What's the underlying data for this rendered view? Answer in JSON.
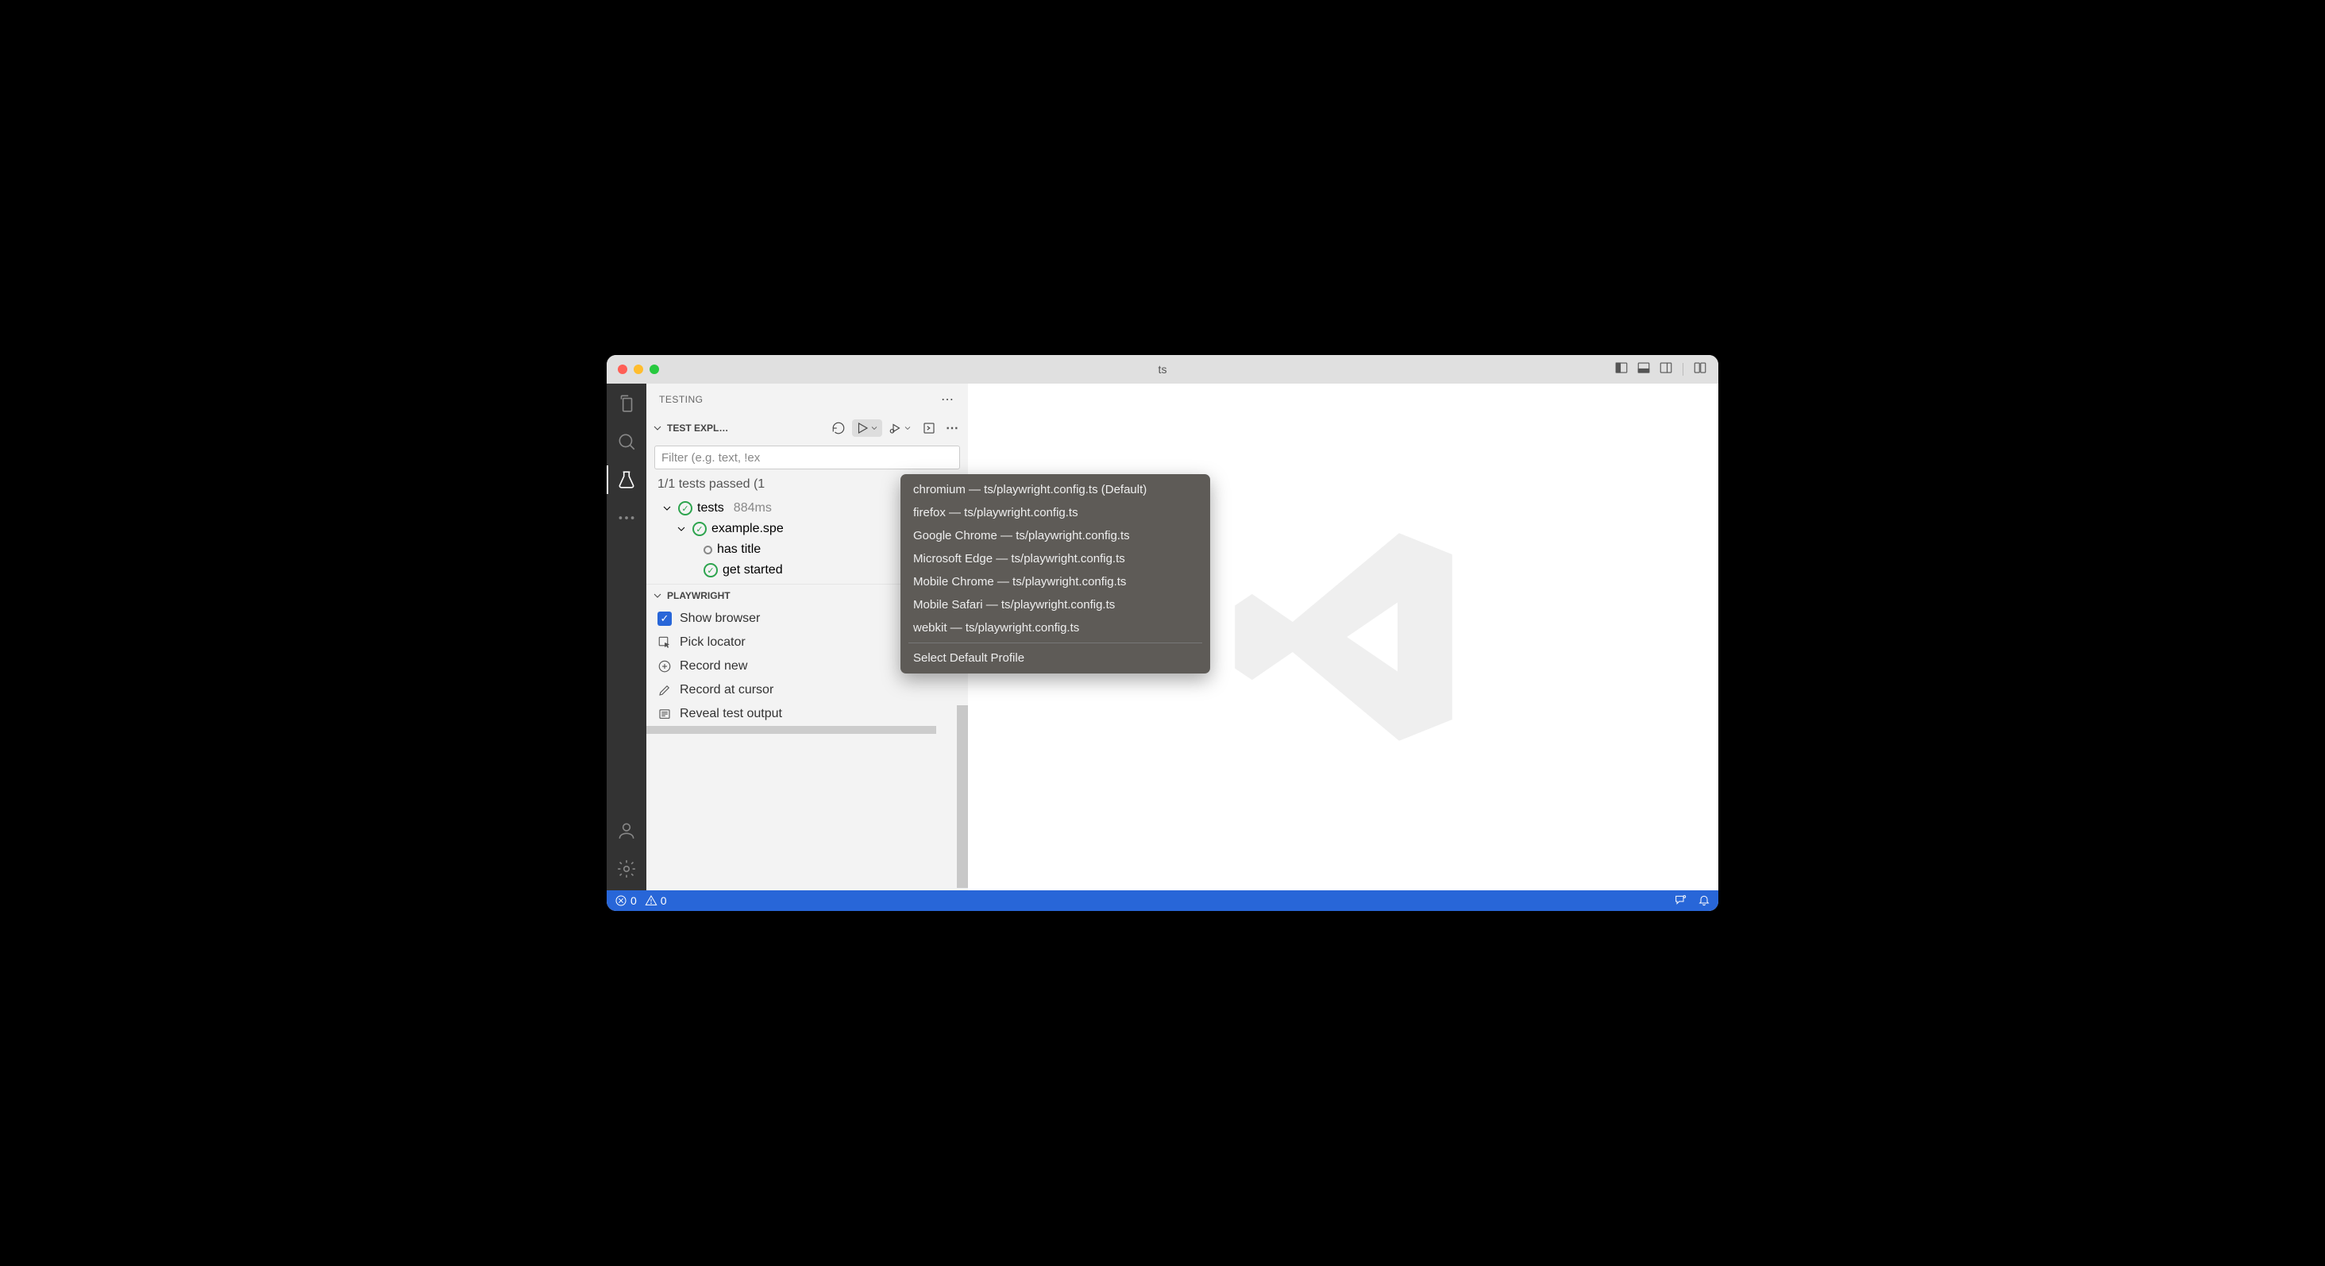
{
  "window": {
    "title": "ts"
  },
  "sidebar": {
    "panel_title": "TESTING",
    "sections": {
      "explorer_title": "TEST EXPL…",
      "playwright_title": "PLAYWRIGHT"
    },
    "filter_placeholder": "Filter (e.g. text, !ex",
    "summary": "1/1 tests passed (1",
    "tree": {
      "root_label": "tests",
      "root_duration": "884ms",
      "file_label": "example.spe",
      "test1": "has title",
      "test2": "get started"
    },
    "playwright": {
      "show_browser": "Show browser",
      "pick_locator": "Pick locator",
      "record_new": "Record new",
      "record_at_cursor": "Record at cursor",
      "reveal_output": "Reveal test output"
    }
  },
  "menu": {
    "items": [
      "chromium — ts/playwright.config.ts (Default)",
      "firefox — ts/playwright.config.ts",
      "Google Chrome — ts/playwright.config.ts",
      "Microsoft Edge — ts/playwright.config.ts",
      "Mobile Chrome — ts/playwright.config.ts",
      "Mobile Safari — ts/playwright.config.ts",
      "webkit — ts/playwright.config.ts"
    ],
    "select_default": "Select Default Profile"
  },
  "statusbar": {
    "errors": "0",
    "warnings": "0"
  }
}
